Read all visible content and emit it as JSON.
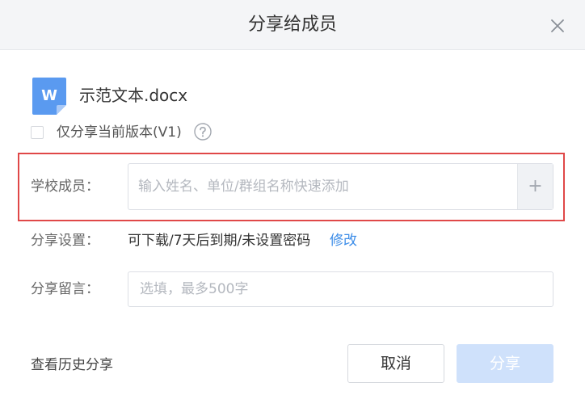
{
  "dialog": {
    "title": "分享给成员",
    "close_icon": "close-icon"
  },
  "file": {
    "icon": "word-doc-icon",
    "icon_letter": "W",
    "name": "示范文本.docx"
  },
  "version_option": {
    "label": "仅分享当前版本(V1)",
    "checked": false,
    "help_icon": "question-circle-icon"
  },
  "members": {
    "label": "学校成员：",
    "placeholder": "输入姓名、单位/群组名称快速添加",
    "value": "",
    "add_label": "+"
  },
  "settings": {
    "label": "分享设置：",
    "value": "可下载/7天后到期/未设置密码",
    "modify_label": "修改"
  },
  "message": {
    "label": "分享留言：",
    "placeholder": "选填，最多500字",
    "value": ""
  },
  "footer": {
    "history_label": "查看历史分享",
    "cancel_label": "取消",
    "share_label": "分享"
  },
  "colors": {
    "accent": "#3d8de8",
    "word_icon": "#5a9af0",
    "highlight": "#e04848",
    "share_disabled": "#cfe1fb"
  }
}
